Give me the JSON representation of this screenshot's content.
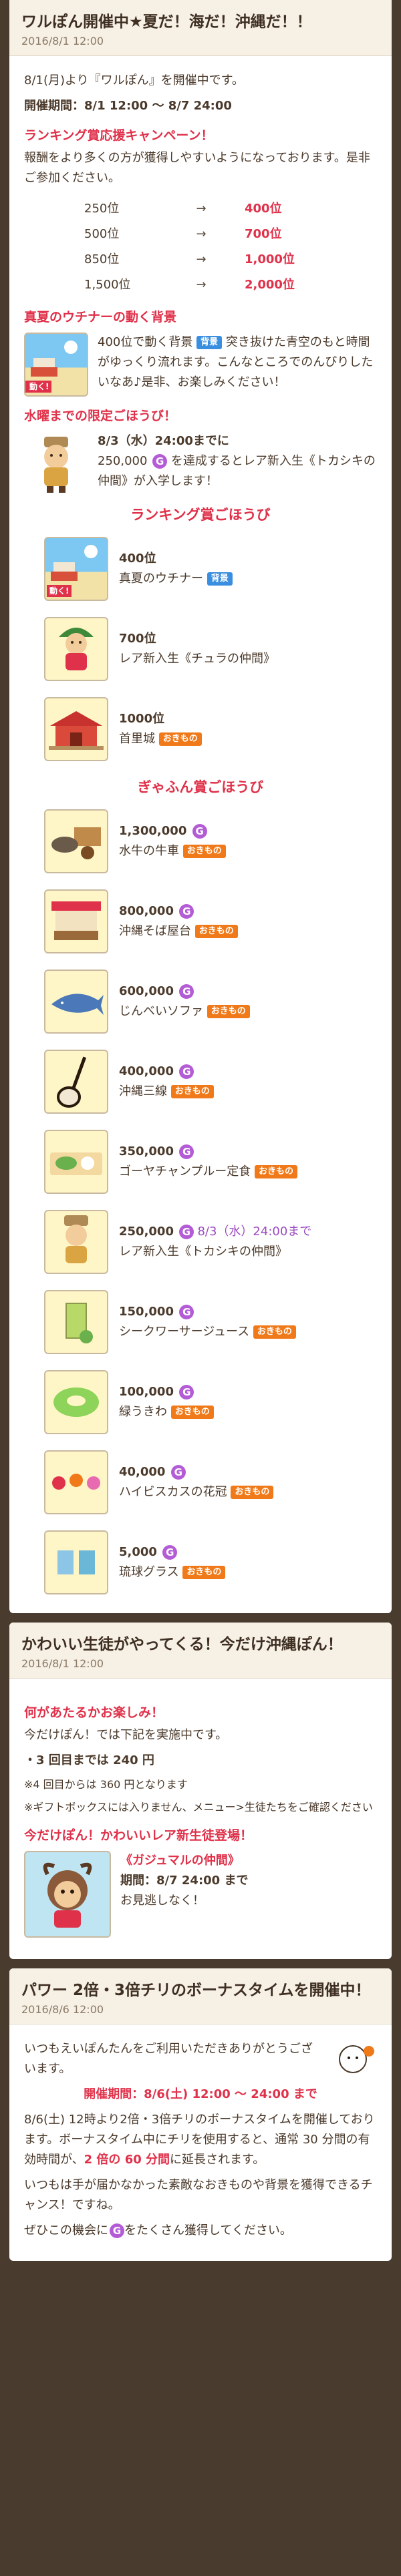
{
  "articles": [
    {
      "title": "ワルぽん開催中★夏だ！海だ！沖縄だ！！",
      "date": "2016/8/1 12:00",
      "intro": "8/1(月)より『ワルぽん』を開催中です。",
      "period_label": "開催期間",
      "period_value": "：8/1 12:00 〜 8/7 24:00",
      "campaign_heading": "ランキング賞応援キャンペーン！",
      "campaign_text": "報酬をより多くの方が獲得しやすいようになっております。是非ご参加ください。",
      "rank_changes": [
        {
          "from": "250位",
          "arrow": "→",
          "to": "400位"
        },
        {
          "from": "500位",
          "arrow": "→",
          "to": "700位"
        },
        {
          "from": "850位",
          "arrow": "→",
          "to": "1,000位"
        },
        {
          "from": "1,500位",
          "arrow": "→",
          "to": "2,000位"
        }
      ],
      "bg_heading": "真夏のウチナーの動く背景",
      "bg_text_1": "400位で動く背景",
      "bg_tag": "背景",
      "bg_text_2": "突き抜けた青空のもと時間がゆっくり流れます。こんなところでのんびりしたいなあ♪是非、お楽しみください！",
      "bg_move": "動く!",
      "limited_heading": "水曜までの限定ごほうび！",
      "limited_date": "8/3（水）24:00までに",
      "limited_text": "250,000",
      "limited_text_2": "を達成するとレア新入生《トカシキの仲間》が入学します！",
      "ranking_reward_heading": "ランキング賞ごほうび",
      "ranking_rewards": [
        {
          "pos": "400位",
          "name": "真夏のウチナー",
          "tag": "背景",
          "tagtype": "blue",
          "icon": "summer-scenery-icon"
        },
        {
          "pos": "700位",
          "name": "レア新入生《チュラの仲間》",
          "tag": "",
          "tagtype": "",
          "icon": "student-chura-icon"
        },
        {
          "pos": "1000位",
          "name": "首里城",
          "tag": "おきもの",
          "tagtype": "orange",
          "icon": "shuri-castle-icon"
        }
      ],
      "gyafun_heading": "ぎゃふん賞ごほうび",
      "gyafun_rewards": [
        {
          "pos": "1,300,000",
          "name": "水牛の牛車",
          "tag": "おきもの",
          "extra": "",
          "icon": "buffalo-cart-icon"
        },
        {
          "pos": "800,000",
          "name": "沖縄そば屋台",
          "tag": "おきもの",
          "extra": "",
          "icon": "soba-stall-icon"
        },
        {
          "pos": "600,000",
          "name": "じんべいソファ",
          "tag": "おきもの",
          "extra": "",
          "icon": "whale-shark-sofa-icon"
        },
        {
          "pos": "400,000",
          "name": "沖縄三線",
          "tag": "おきもの",
          "extra": "",
          "icon": "sanshin-icon"
        },
        {
          "pos": "350,000",
          "name": "ゴーヤチャンプルー定食",
          "tag": "おきもの",
          "extra": "",
          "icon": "champuru-icon"
        },
        {
          "pos": "250,000",
          "name": "レア新入生《トカシキの仲間》",
          "tag": "",
          "extra": "8/3（水）24:00まで",
          "icon": "student-tokashiki-icon"
        },
        {
          "pos": "150,000",
          "name": "シークワーサージュース",
          "tag": "おきもの",
          "extra": "",
          "icon": "juice-icon"
        },
        {
          "pos": "100,000",
          "name": "緑うきわ",
          "tag": "おきもの",
          "extra": "",
          "icon": "float-ring-icon"
        },
        {
          "pos": "40,000",
          "name": "ハイビスカスの花冠",
          "tag": "おきもの",
          "extra": "",
          "icon": "hibiscus-icon"
        },
        {
          "pos": "5,000",
          "name": "琉球グラス",
          "tag": "おきもの",
          "extra": "",
          "icon": "ryukyu-glass-icon"
        }
      ]
    },
    {
      "title": "かわいい生徒がやってくる！今だけ沖縄ぽん！",
      "date": "2016/8/1 12:00",
      "fun_heading": "何があたるかお楽しみ！",
      "fun_text": "今だけぽん！では下記を実施中です。",
      "point_prefix": "・3 回目までは ",
      "point_value": "240 円",
      "note_1": "※4 回目からは 360 円となります",
      "note_2": "※ギフトボックスには入りません、メニュー>生徒たちをご確認ください",
      "rare_heading": "今だけぽん！かわいいレア新生徒登場！",
      "rare_name": "《ガジュマルの仲間》",
      "rare_period_label": "期間",
      "rare_period": "：8/7 24:00 まで",
      "rare_note": "お見逃しなく！"
    },
    {
      "title": "パワー 2倍・3倍チリのボーナスタイムを開催中！",
      "date": "2016/8/6 12:00",
      "greeting": "いつもえいぽんたんをご利用いただきありがとうございます。",
      "period_label": "開催期間",
      "period_value": "：8/6(土) 12:00 〜 24:00 まで",
      "body_1": "8/6(土) 12時より2倍・3倍チリのボーナスタイムを開催しております。ボーナスタイム中にチリを使用すると、通常 30 分間の有効時間が、",
      "body_red_1": "2 倍の 60 分間",
      "body_2": "に延長されます。",
      "body_3": "いつもは手が届かなかった素敵なおきものや背景を獲得できるチャンス！ですね。",
      "body_4": "ぜひこの機会に",
      "body_5": "をたくさん獲得してください。"
    }
  ],
  "g_glyph": "G",
  "colors": {
    "accent": "#e0314a",
    "purple": "#b45cd6",
    "blue_tag": "#3a8ee0",
    "orange_tag": "#f07a1a"
  }
}
